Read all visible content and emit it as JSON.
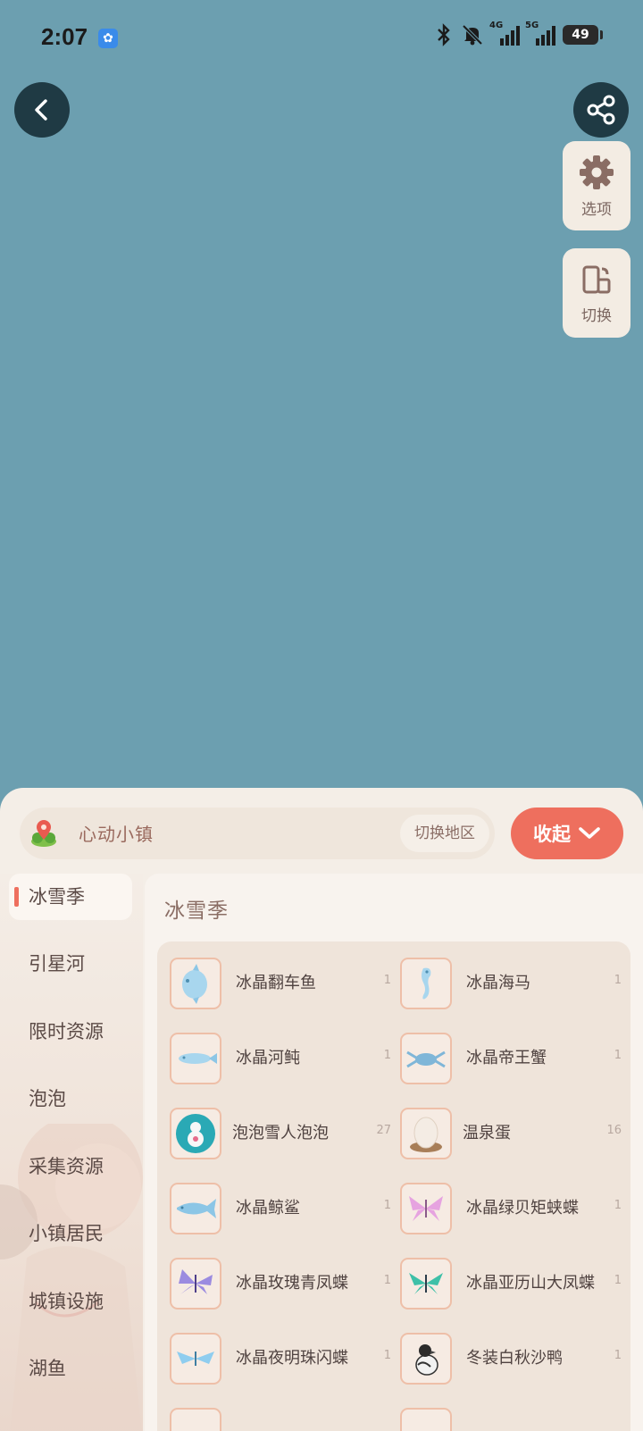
{
  "status_bar": {
    "time": "2:07",
    "network1": "4G",
    "network2": "5G",
    "battery": "49"
  },
  "tools": {
    "options_label": "选项",
    "switch_label": "切换"
  },
  "panel": {
    "town_name": "心动小镇",
    "switch_region_label": "切换地区",
    "collapse_label": "收起"
  },
  "sidebar": {
    "items": [
      {
        "label": "冰雪季",
        "active": true
      },
      {
        "label": "引星河"
      },
      {
        "label": "限时资源"
      },
      {
        "label": "泡泡"
      },
      {
        "label": "采集资源"
      },
      {
        "label": "小镇居民"
      },
      {
        "label": "城镇设施"
      },
      {
        "label": "湖鱼"
      }
    ]
  },
  "content": {
    "section_title": "冰雪季",
    "items": [
      {
        "name": "冰晶翻车鱼",
        "count": "1",
        "icon": "sunfish-icon"
      },
      {
        "name": "冰晶海马",
        "count": "1",
        "icon": "seahorse-icon"
      },
      {
        "name": "冰晶河鲀",
        "count": "1",
        "icon": "pufferfish-icon"
      },
      {
        "name": "冰晶帝王蟹",
        "count": "1",
        "icon": "crab-icon"
      },
      {
        "name": "泡泡雪人泡泡",
        "count": "27",
        "icon": "snowman-bubble-icon"
      },
      {
        "name": "温泉蛋",
        "count": "16",
        "icon": "egg-icon"
      },
      {
        "name": "冰晶鲸鲨",
        "count": "1",
        "icon": "whale-shark-icon"
      },
      {
        "name": "冰晶绿贝矩蛱蝶",
        "count": "1",
        "icon": "butterfly-pink-icon"
      },
      {
        "name": "冰晶玫瑰青凤蝶",
        "count": "1",
        "icon": "butterfly-purple-icon"
      },
      {
        "name": "冰晶亚历山大凤蝶",
        "count": "1",
        "icon": "butterfly-teal-icon"
      },
      {
        "name": "冰晶夜明珠闪蝶",
        "count": "1",
        "icon": "butterfly-blue-icon"
      },
      {
        "name": "冬装白秋沙鸭",
        "count": "1",
        "icon": "duck-icon"
      }
    ]
  },
  "colors": {
    "map_background": "#6c9fb0",
    "accent": "#ee6f5e",
    "panel": "#f4eee7"
  }
}
